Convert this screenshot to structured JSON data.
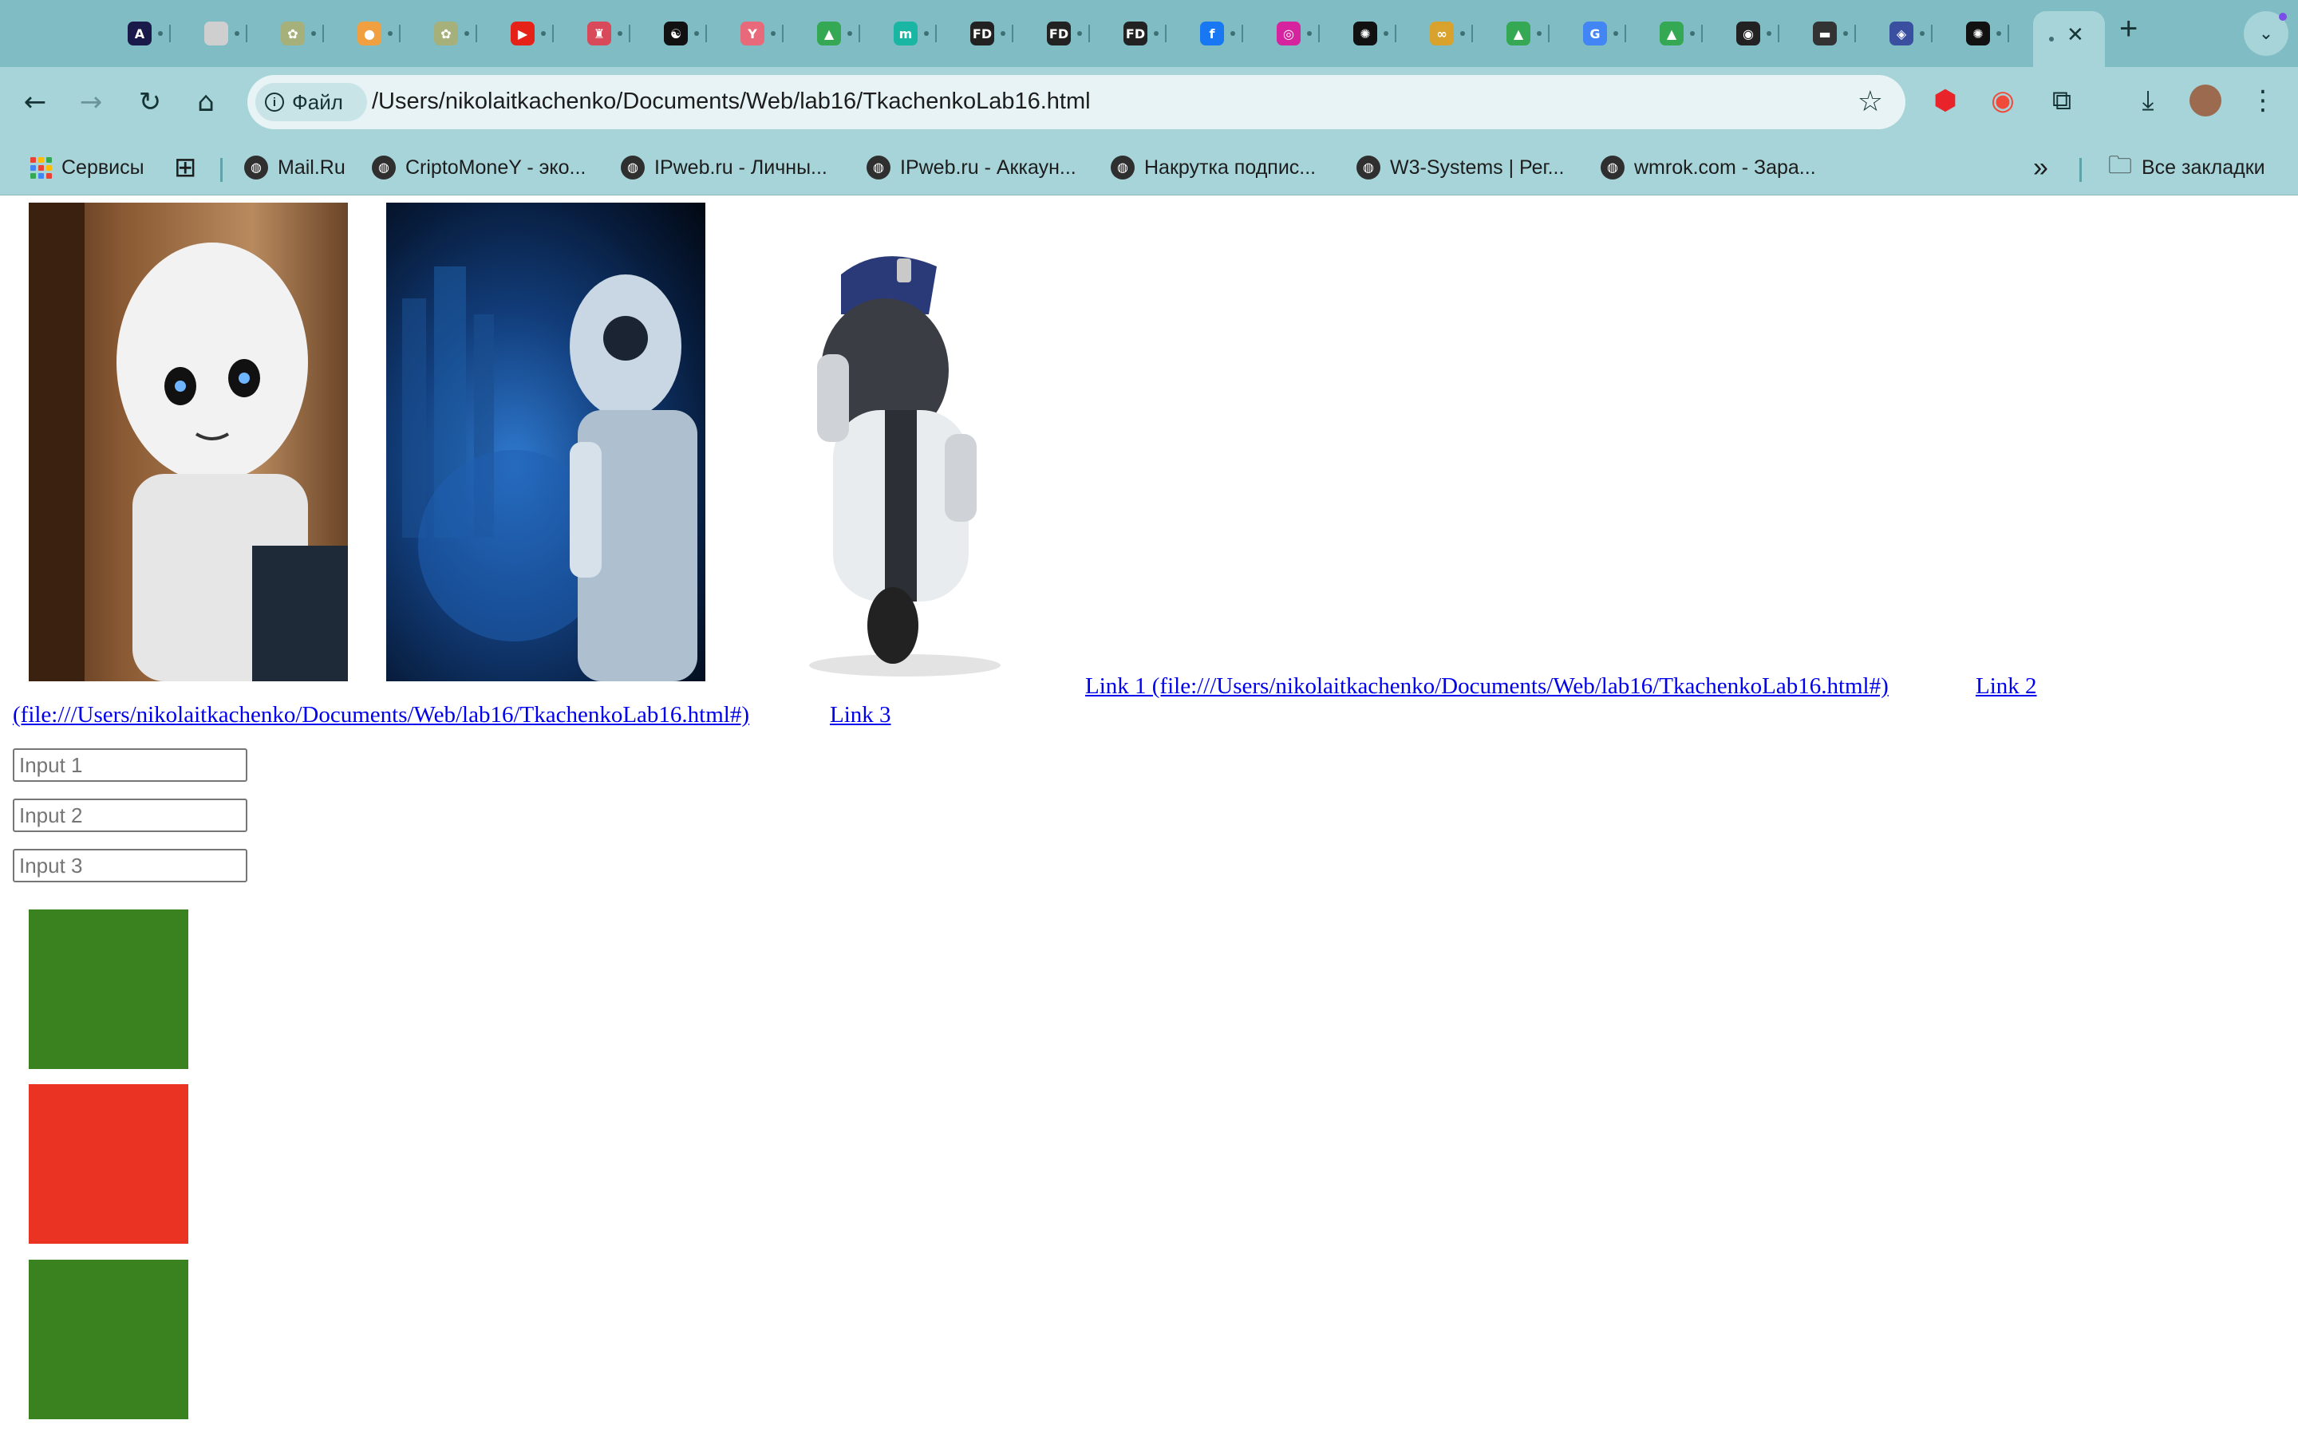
{
  "browser": {
    "tabs": [
      {
        "icon": "bear-icon",
        "glyph": "A",
        "color": "#1a1a4a"
      },
      {
        "icon": "circle-icon",
        "glyph": "",
        "color": "#cfcfcf"
      },
      {
        "icon": "flower-icon",
        "glyph": "✿",
        "color": "#a6b07a"
      },
      {
        "icon": "chick-icon",
        "glyph": "●",
        "color": "#f0a040"
      },
      {
        "icon": "flower-icon",
        "glyph": "✿",
        "color": "#a6b07a"
      },
      {
        "icon": "youtube-icon",
        "glyph": "▶",
        "color": "#e62117"
      },
      {
        "icon": "shield-icon",
        "glyph": "♜",
        "color": "#d84a5a"
      },
      {
        "icon": "yin-yang-icon",
        "glyph": "☯",
        "color": "#111111"
      },
      {
        "icon": "fox-icon",
        "glyph": "Y",
        "color": "#e86a7a"
      },
      {
        "icon": "drive-icon",
        "glyph": "▲",
        "color": "#34a853"
      },
      {
        "icon": "m-app-icon",
        "glyph": "m",
        "color": "#19b7a3"
      },
      {
        "icon": "fd-icon",
        "glyph": "FD",
        "color": "#222222"
      },
      {
        "icon": "fd-icon",
        "glyph": "FD",
        "color": "#222222"
      },
      {
        "icon": "fd-icon",
        "glyph": "FD",
        "color": "#222222"
      },
      {
        "icon": "facebook-icon",
        "glyph": "f",
        "color": "#1877f2"
      },
      {
        "icon": "instagram-icon",
        "glyph": "◎",
        "color": "#d6249f"
      },
      {
        "icon": "openai-icon",
        "glyph": "✺",
        "color": "#111111"
      },
      {
        "icon": "infinity-icon",
        "glyph": "∞",
        "color": "#d8a22c"
      },
      {
        "icon": "drive-icon",
        "glyph": "▲",
        "color": "#34a853"
      },
      {
        "icon": "google-icon",
        "glyph": "G",
        "color": "#4285f4"
      },
      {
        "icon": "drive-icon",
        "glyph": "▲",
        "color": "#34a853"
      },
      {
        "icon": "github-icon",
        "glyph": "◉",
        "color": "#222222"
      },
      {
        "icon": "cap-icon",
        "glyph": "▬",
        "color": "#333333"
      },
      {
        "icon": "emblem-icon",
        "glyph": "◈",
        "color": "#3a4fa0"
      },
      {
        "icon": "openai-icon",
        "glyph": "✺",
        "color": "#111111"
      }
    ],
    "close_glyph": "✕",
    "new_tab_glyph": "+",
    "tab_search_glyph": "⌄",
    "nav": {
      "back": "←",
      "forward": "→",
      "reload": "↻",
      "home": "⌂"
    },
    "site_chip_label": "Файл",
    "info_glyph": "i",
    "url": "/Users/nikolaitkachenko/Documents/Web/lab16/TkachenkoLab16.html",
    "star_glyph": "☆",
    "extensions": [
      {
        "icon": "ublock-icon",
        "glyph": "⬢",
        "color": "#e8232a"
      },
      {
        "icon": "record-icon",
        "glyph": "◉",
        "color": "#f04a3a"
      },
      {
        "icon": "puzzle-icon",
        "glyph": "⧉",
        "color": "#163436"
      },
      {
        "icon": "download-icon",
        "glyph": "⤓",
        "color": "#163436"
      },
      {
        "icon": "avatar",
        "glyph": "",
        "color": "#9b6a4f"
      },
      {
        "icon": "kebab-menu-icon",
        "glyph": "⋮",
        "color": "#163436"
      }
    ],
    "bookmarks": {
      "apps_label": "Сервисы",
      "items": [
        {
          "label": "Mail.Ru",
          "icon": "globe-icon"
        },
        {
          "label": "CriptoMoneY - эко...",
          "icon": "coin-icon"
        },
        {
          "label": "IPweb.ru - Личны...",
          "icon": "globe-icon"
        },
        {
          "label": "IPweb.ru - Аккаун...",
          "icon": "globe-icon"
        },
        {
          "label": "Накрутка подпис...",
          "icon": "spiral-icon"
        },
        {
          "label": "W3-Systems | Рег...",
          "icon": "chart-icon"
        },
        {
          "label": "wmrok.com - Зара...",
          "icon": "w-icon"
        }
      ],
      "overflow_glyph": "»",
      "all_bookmarks_label": "Все закладки"
    }
  },
  "page": {
    "images": [
      {
        "name": "robot-photo-1",
        "description_icon": "robot-icon"
      },
      {
        "name": "robot-photo-2",
        "description_icon": "robot-icon"
      },
      {
        "name": "robot-photo-3",
        "description_icon": "robot-icon"
      }
    ],
    "links": {
      "link1": "Link 1 (file:///Users/nikolaitkachenko/Documents/Web/lab16/TkachenkoLab16.html#)",
      "link2": "Link 2",
      "link2_cont": "(file:///Users/nikolaitkachenko/Documents/Web/lab16/TkachenkoLab16.html#)",
      "link3": "Link 3"
    },
    "inputs": [
      {
        "placeholder": "Input 1",
        "value": ""
      },
      {
        "placeholder": "Input 2",
        "value": ""
      },
      {
        "placeholder": "Input 3",
        "value": ""
      }
    ],
    "squares": [
      {
        "color": "#3a8220"
      },
      {
        "color": "#ea3323"
      },
      {
        "color": "#3a8220"
      }
    ]
  }
}
